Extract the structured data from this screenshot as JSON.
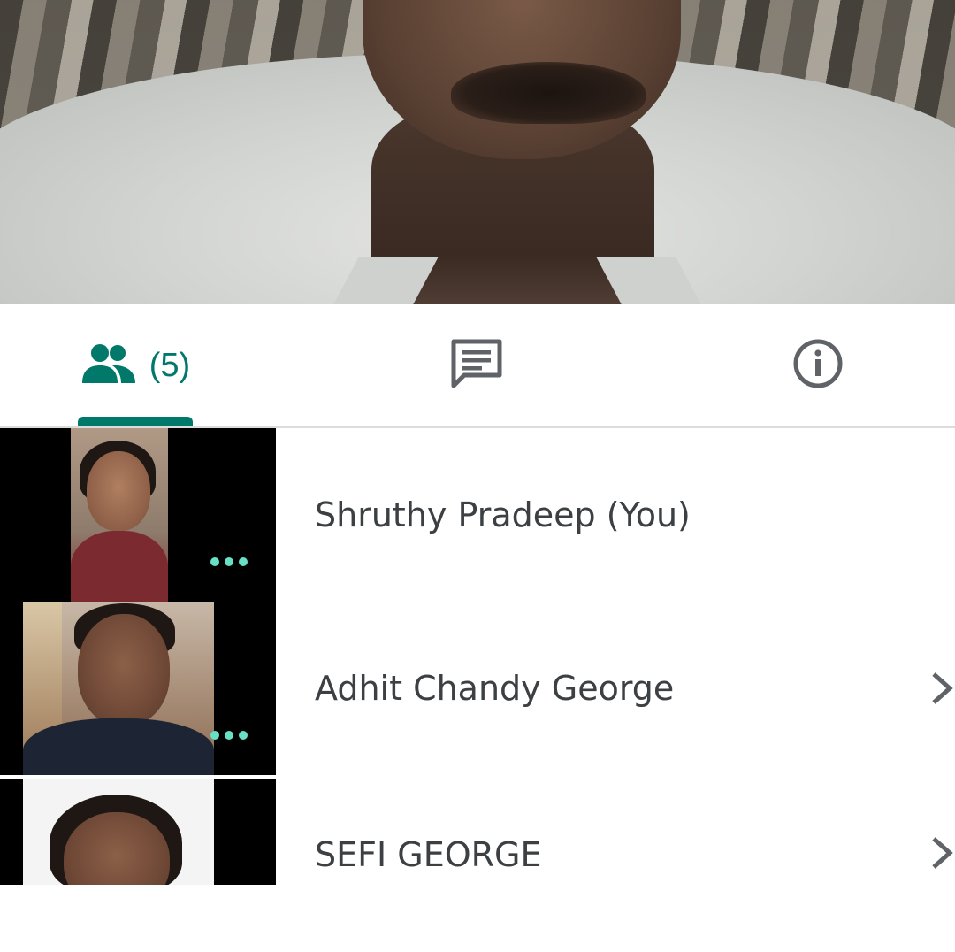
{
  "main_video": {
    "label": ""
  },
  "tabs": {
    "people": {
      "icon": "people-icon",
      "count": "(5)",
      "selected": true,
      "accent": "#00796b"
    },
    "chat": {
      "icon": "chat-icon"
    },
    "info": {
      "icon": "info-icon"
    }
  },
  "participants": [
    {
      "name": "Shruthy Pradeep (You)",
      "has_chevron": false,
      "speaking_indicator": true
    },
    {
      "name": "Adhit Chandy George",
      "has_chevron": true,
      "speaking_indicator": true
    },
    {
      "name": "SEFI GEORGE",
      "has_chevron": true,
      "speaking_indicator": false
    }
  ],
  "colors": {
    "accent": "#00796b",
    "dots": "#68e0c4",
    "text": "#3c4043"
  }
}
